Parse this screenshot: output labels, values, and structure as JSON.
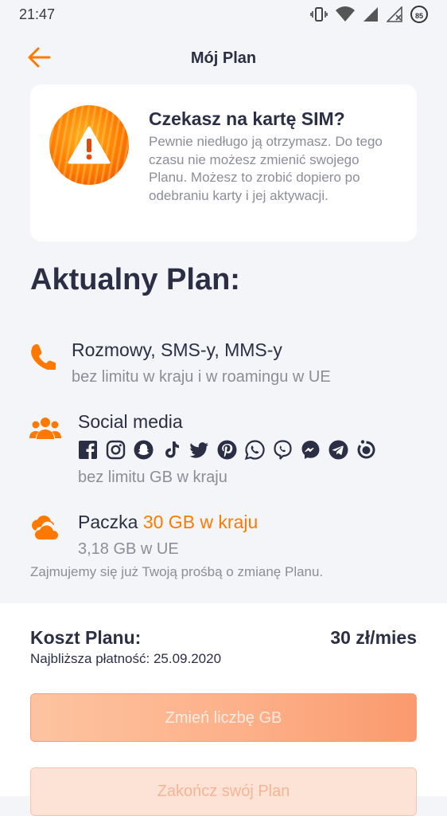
{
  "status_bar": {
    "time": "21:47",
    "battery": "85"
  },
  "header": {
    "title": "Mój Plan"
  },
  "sim_notice": {
    "title": "Czekasz na kartę SIM?",
    "description": "Pewnie niedługo ją otrzymasz.  Do tego czasu nie możesz zmienić swojego Planu. Możesz to zrobić dopiero po odebraniu karty i jej aktywacji."
  },
  "plan": {
    "heading": "Aktualny Plan:",
    "calls": {
      "title": "Rozmowy, SMS-y, MMS-y",
      "subtitle": "bez limitu w kraju i w roamingu w UE"
    },
    "social": {
      "title": "Social media",
      "subtitle": "bez limitu GB w kraju",
      "icons": [
        "facebook-icon",
        "instagram-icon",
        "snapchat-icon",
        "tiktok-icon",
        "twitter-icon",
        "pinterest-icon",
        "whatsapp-icon",
        "viber-icon",
        "messenger-icon",
        "telegram-icon",
        "other-app-icon"
      ]
    },
    "data": {
      "title_prefix": "Paczka ",
      "title_accent": "30 GB w kraju",
      "subtitle": "3,18 GB w UE"
    },
    "pending_note": "Zajmujemy się już Twoją prośbą o zmianę Planu."
  },
  "cost": {
    "label": "Koszt Planu:",
    "value": "30 zł/mies",
    "next_payment": "Najbliższa płatność: 25.09.2020"
  },
  "buttons": {
    "change_gb": "Zmień liczbę GB",
    "end_plan": "Zakończ swój Plan"
  },
  "colors": {
    "accent": "#ff7900",
    "text": "#2b2f45",
    "muted": "#8b8d99"
  }
}
